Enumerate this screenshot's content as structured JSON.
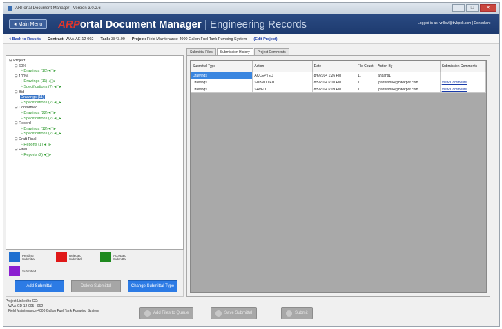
{
  "window": {
    "title": "ARPortal Document Manager - Version 3.0.2.6",
    "min": "–",
    "max": "□",
    "close": "✕"
  },
  "header": {
    "menu_button": "Main Menu",
    "logo_text": "ARP",
    "title_main": "ortal Document Manager",
    "title_sep": "|",
    "title_sub": "Engineering Records",
    "logged_in": "Logged in as: vrtllbvl@bvkpolt.com | Consultant |"
  },
  "info": {
    "back_link": "< Back to Results",
    "contract_label": "Contract:",
    "contract_value": "WAA-AE-12-002",
    "task_label": "Task:",
    "task_value": "3843.00",
    "project_label": "Project:",
    "project_value": "Field Maintenance 4000 Gallon Fuel Tank Pumping System",
    "edit_link": "(Edit Project)"
  },
  "tabs": [
    "Submittal Files",
    "Submission History",
    "Project Comments"
  ],
  "tree": [
    {
      "text": "⊟ Project",
      "indent": 0,
      "style": ""
    },
    {
      "text": "⊟ 60%",
      "indent": 1,
      "style": ""
    },
    {
      "text": "└ Drawings (10) ◂▢▸",
      "indent": 2,
      "style": "green"
    },
    {
      "text": "⊟ 100%",
      "indent": 1,
      "style": ""
    },
    {
      "text": "├ Drawings (11) ◂▢▸",
      "indent": 2,
      "style": "green"
    },
    {
      "text": "└ Specifications (7) ◂▢▸",
      "indent": 2,
      "style": "green"
    },
    {
      "text": "⊟ Bid",
      "indent": 1,
      "style": ""
    },
    {
      "text": "Drawings (11)",
      "indent": 2,
      "style": "green",
      "selected": true
    },
    {
      "text": "└ Specifications (2) ◂▢▸",
      "indent": 2,
      "style": "green"
    },
    {
      "text": "⊟ Conformed",
      "indent": 1,
      "style": ""
    },
    {
      "text": "├ Drawings (22) ◂▢▸",
      "indent": 2,
      "style": "green"
    },
    {
      "text": "└ Specifications (2) ◂▢▸",
      "indent": 2,
      "style": "green"
    },
    {
      "text": "⊟ Record",
      "indent": 1,
      "style": ""
    },
    {
      "text": "├ Drawings (12) ◂▢▸",
      "indent": 2,
      "style": "green"
    },
    {
      "text": "└ Specifications (2) ◂▢▸",
      "indent": 2,
      "style": "green"
    },
    {
      "text": "⊟ Draft Final",
      "indent": 1,
      "style": ""
    },
    {
      "text": "└ Reports (1) ◂▢▸",
      "indent": 2,
      "style": "green"
    },
    {
      "text": "⊟ Final",
      "indent": 1,
      "style": ""
    },
    {
      "text": "└ Reports (2) ◂▢▸",
      "indent": 2,
      "style": "green"
    }
  ],
  "legend": {
    "pending": "Pending Submittal",
    "rejected": "Rejected Submittal",
    "accepted": "Accepted Submittal",
    "submitted": "Submitted",
    "colors": {
      "pending": "#1f6fd0",
      "rejected": "#e01818",
      "accepted": "#1f8a1f",
      "submitted": "#8b1fd0"
    }
  },
  "left_buttons": {
    "add": "Add Submittal",
    "delete": "Delete Submittal",
    "change": "Change Submittal Type"
  },
  "history": {
    "columns": [
      "Submittal Type",
      "Action",
      "Date",
      "File Count",
      "Action By",
      "Submission Comments"
    ],
    "rows": [
      [
        "Drawings",
        "ACCEPTED",
        "8/6/2014 1:26 PM",
        "11",
        "ahsans1",
        ""
      ],
      [
        "Drawings",
        "SUBMITTED",
        "8/5/2014 6:10 PM",
        "11",
        "jpatterson4@hwarpot.com",
        "View Comments"
      ],
      [
        "Drawings",
        "SAVED",
        "8/5/2014 6:09 PM",
        "11",
        "jpatterson4@hwarpot.com",
        "View Comments"
      ]
    ]
  },
  "footer": {
    "line1": "Project Linked to CD:",
    "line2": "WAA-CD-12-005 - 062",
    "line3": "Field Maintenance 4000 Gallon Fuel Tank Pumping System",
    "btn_queue": "Add Files to Queue",
    "btn_save": "Save Submittal",
    "btn_submit": "Submit"
  }
}
